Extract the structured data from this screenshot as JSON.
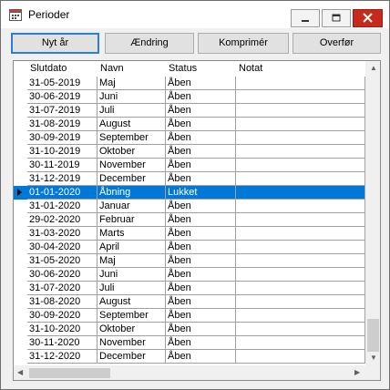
{
  "window": {
    "title": "Perioder"
  },
  "toolbar": {
    "new_year": "Nyt år",
    "change": "Ændring",
    "compress": "Komprimér",
    "transfer": "Overfør"
  },
  "grid": {
    "headers": {
      "date": "Slutdato",
      "name": "Navn",
      "status": "Status",
      "note": "Notat"
    },
    "rows": [
      {
        "date": "31-05-2019",
        "name": "Maj",
        "status": "Åben",
        "note": ""
      },
      {
        "date": "30-06-2019",
        "name": "Juni",
        "status": "Åben",
        "note": ""
      },
      {
        "date": "31-07-2019",
        "name": "Juli",
        "status": "Åben",
        "note": ""
      },
      {
        "date": "31-08-2019",
        "name": "August",
        "status": "Åben",
        "note": ""
      },
      {
        "date": "30-09-2019",
        "name": "September",
        "status": "Åben",
        "note": ""
      },
      {
        "date": "31-10-2019",
        "name": "Oktober",
        "status": "Åben",
        "note": ""
      },
      {
        "date": "30-11-2019",
        "name": "November",
        "status": "Åben",
        "note": ""
      },
      {
        "date": "31-12-2019",
        "name": "December",
        "status": "Åben",
        "note": ""
      },
      {
        "date": "01-01-2020",
        "name": "Åbning",
        "status": "Lukket",
        "note": ""
      },
      {
        "date": "31-01-2020",
        "name": "Januar",
        "status": "Åben",
        "note": ""
      },
      {
        "date": "29-02-2020",
        "name": "Februar",
        "status": "Åben",
        "note": ""
      },
      {
        "date": "31-03-2020",
        "name": "Marts",
        "status": "Åben",
        "note": ""
      },
      {
        "date": "30-04-2020",
        "name": "April",
        "status": "Åben",
        "note": ""
      },
      {
        "date": "31-05-2020",
        "name": "Maj",
        "status": "Åben",
        "note": ""
      },
      {
        "date": "30-06-2020",
        "name": "Juni",
        "status": "Åben",
        "note": ""
      },
      {
        "date": "31-07-2020",
        "name": "Juli",
        "status": "Åben",
        "note": ""
      },
      {
        "date": "31-08-2020",
        "name": "August",
        "status": "Åben",
        "note": ""
      },
      {
        "date": "30-09-2020",
        "name": "September",
        "status": "Åben",
        "note": ""
      },
      {
        "date": "31-10-2020",
        "name": "Oktober",
        "status": "Åben",
        "note": ""
      },
      {
        "date": "30-11-2020",
        "name": "November",
        "status": "Åben",
        "note": ""
      },
      {
        "date": "31-12-2020",
        "name": "December",
        "status": "Åben",
        "note": ""
      }
    ],
    "selected_index": 8
  },
  "colors": {
    "selection": "#0078d7",
    "close_button": "#c42b1c",
    "default_button_border": "#2c7dd6"
  },
  "icons": [
    "calendar-icon",
    "minimize-icon",
    "maximize-icon",
    "close-icon",
    "current-row-indicator-icon",
    "scroll-up-arrow-icon",
    "scroll-down-arrow-icon",
    "scroll-left-arrow-icon",
    "scroll-right-arrow-icon"
  ]
}
